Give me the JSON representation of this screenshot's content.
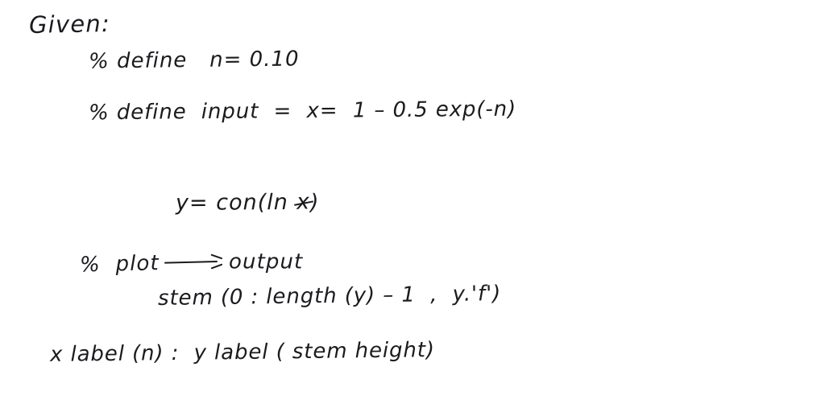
{
  "page": {
    "kind": "handwritten-note",
    "background_color": "#ffffff",
    "ink_color": "#1b1b1f"
  },
  "note": {
    "heading": "Given:",
    "line_define_n": "% define   n= 0.10",
    "line_define_input": "% define  input  =  x=  1 – 0.5 exp(-n)",
    "line_y_prefix": "y= con(ln ",
    "line_y_variable": "x",
    "line_y_suffix": ")",
    "line_plot_prefix": "%  plot",
    "line_plot_suffix": "output",
    "arrow_glyph": "right-arrow",
    "line_stem": "stem (0 : length (y) – 1  ,  y.'f')",
    "line_labels": "x label (n) :  y label ( stem height)"
  }
}
